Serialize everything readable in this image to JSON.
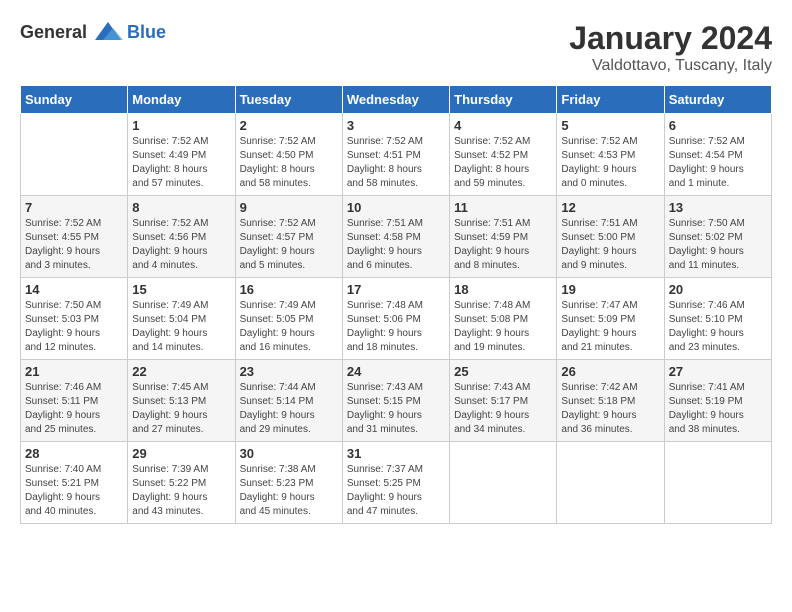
{
  "header": {
    "logo_general": "General",
    "logo_blue": "Blue",
    "title": "January 2024",
    "subtitle": "Valdottavo, Tuscany, Italy"
  },
  "days_of_week": [
    "Sunday",
    "Monday",
    "Tuesday",
    "Wednesday",
    "Thursday",
    "Friday",
    "Saturday"
  ],
  "weeks": [
    [
      {
        "day": "",
        "content": ""
      },
      {
        "day": "1",
        "content": "Sunrise: 7:52 AM\nSunset: 4:49 PM\nDaylight: 8 hours\nand 57 minutes."
      },
      {
        "day": "2",
        "content": "Sunrise: 7:52 AM\nSunset: 4:50 PM\nDaylight: 8 hours\nand 58 minutes."
      },
      {
        "day": "3",
        "content": "Sunrise: 7:52 AM\nSunset: 4:51 PM\nDaylight: 8 hours\nand 58 minutes."
      },
      {
        "day": "4",
        "content": "Sunrise: 7:52 AM\nSunset: 4:52 PM\nDaylight: 8 hours\nand 59 minutes."
      },
      {
        "day": "5",
        "content": "Sunrise: 7:52 AM\nSunset: 4:53 PM\nDaylight: 9 hours\nand 0 minutes."
      },
      {
        "day": "6",
        "content": "Sunrise: 7:52 AM\nSunset: 4:54 PM\nDaylight: 9 hours\nand 1 minute."
      }
    ],
    [
      {
        "day": "7",
        "content": "Sunrise: 7:52 AM\nSunset: 4:55 PM\nDaylight: 9 hours\nand 3 minutes."
      },
      {
        "day": "8",
        "content": "Sunrise: 7:52 AM\nSunset: 4:56 PM\nDaylight: 9 hours\nand 4 minutes."
      },
      {
        "day": "9",
        "content": "Sunrise: 7:52 AM\nSunset: 4:57 PM\nDaylight: 9 hours\nand 5 minutes."
      },
      {
        "day": "10",
        "content": "Sunrise: 7:51 AM\nSunset: 4:58 PM\nDaylight: 9 hours\nand 6 minutes."
      },
      {
        "day": "11",
        "content": "Sunrise: 7:51 AM\nSunset: 4:59 PM\nDaylight: 9 hours\nand 8 minutes."
      },
      {
        "day": "12",
        "content": "Sunrise: 7:51 AM\nSunset: 5:00 PM\nDaylight: 9 hours\nand 9 minutes."
      },
      {
        "day": "13",
        "content": "Sunrise: 7:50 AM\nSunset: 5:02 PM\nDaylight: 9 hours\nand 11 minutes."
      }
    ],
    [
      {
        "day": "14",
        "content": "Sunrise: 7:50 AM\nSunset: 5:03 PM\nDaylight: 9 hours\nand 12 minutes."
      },
      {
        "day": "15",
        "content": "Sunrise: 7:49 AM\nSunset: 5:04 PM\nDaylight: 9 hours\nand 14 minutes."
      },
      {
        "day": "16",
        "content": "Sunrise: 7:49 AM\nSunset: 5:05 PM\nDaylight: 9 hours\nand 16 minutes."
      },
      {
        "day": "17",
        "content": "Sunrise: 7:48 AM\nSunset: 5:06 PM\nDaylight: 9 hours\nand 18 minutes."
      },
      {
        "day": "18",
        "content": "Sunrise: 7:48 AM\nSunset: 5:08 PM\nDaylight: 9 hours\nand 19 minutes."
      },
      {
        "day": "19",
        "content": "Sunrise: 7:47 AM\nSunset: 5:09 PM\nDaylight: 9 hours\nand 21 minutes."
      },
      {
        "day": "20",
        "content": "Sunrise: 7:46 AM\nSunset: 5:10 PM\nDaylight: 9 hours\nand 23 minutes."
      }
    ],
    [
      {
        "day": "21",
        "content": "Sunrise: 7:46 AM\nSunset: 5:11 PM\nDaylight: 9 hours\nand 25 minutes."
      },
      {
        "day": "22",
        "content": "Sunrise: 7:45 AM\nSunset: 5:13 PM\nDaylight: 9 hours\nand 27 minutes."
      },
      {
        "day": "23",
        "content": "Sunrise: 7:44 AM\nSunset: 5:14 PM\nDaylight: 9 hours\nand 29 minutes."
      },
      {
        "day": "24",
        "content": "Sunrise: 7:43 AM\nSunset: 5:15 PM\nDaylight: 9 hours\nand 31 minutes."
      },
      {
        "day": "25",
        "content": "Sunrise: 7:43 AM\nSunset: 5:17 PM\nDaylight: 9 hours\nand 34 minutes."
      },
      {
        "day": "26",
        "content": "Sunrise: 7:42 AM\nSunset: 5:18 PM\nDaylight: 9 hours\nand 36 minutes."
      },
      {
        "day": "27",
        "content": "Sunrise: 7:41 AM\nSunset: 5:19 PM\nDaylight: 9 hours\nand 38 minutes."
      }
    ],
    [
      {
        "day": "28",
        "content": "Sunrise: 7:40 AM\nSunset: 5:21 PM\nDaylight: 9 hours\nand 40 minutes."
      },
      {
        "day": "29",
        "content": "Sunrise: 7:39 AM\nSunset: 5:22 PM\nDaylight: 9 hours\nand 43 minutes."
      },
      {
        "day": "30",
        "content": "Sunrise: 7:38 AM\nSunset: 5:23 PM\nDaylight: 9 hours\nand 45 minutes."
      },
      {
        "day": "31",
        "content": "Sunrise: 7:37 AM\nSunset: 5:25 PM\nDaylight: 9 hours\nand 47 minutes."
      },
      {
        "day": "",
        "content": ""
      },
      {
        "day": "",
        "content": ""
      },
      {
        "day": "",
        "content": ""
      }
    ]
  ]
}
